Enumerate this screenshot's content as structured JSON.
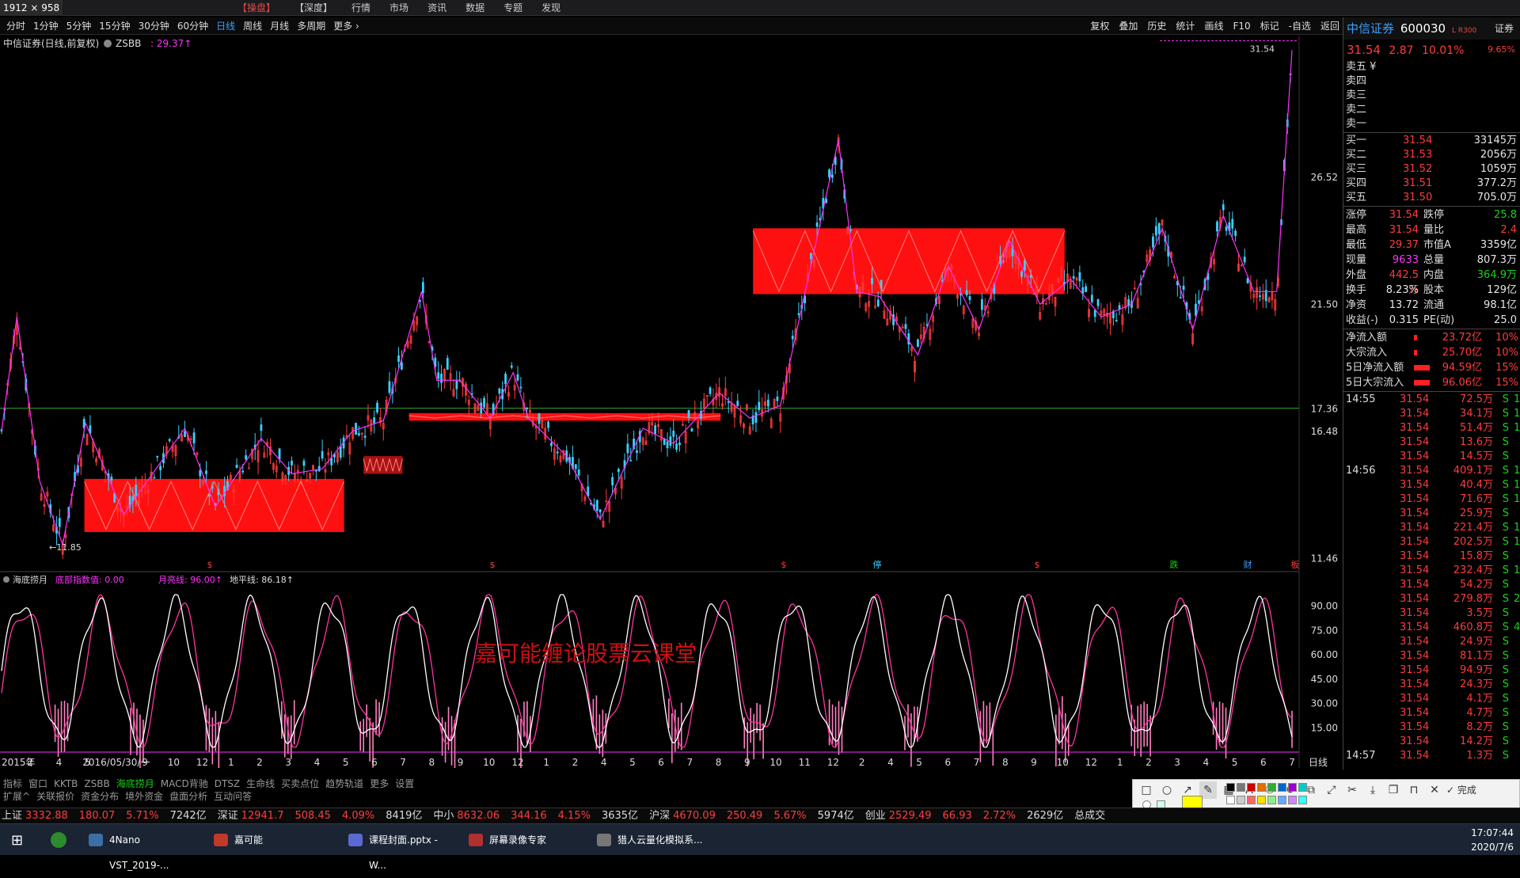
{
  "window": {
    "dims_label": "1912 × 958"
  },
  "top_menu": [
    {
      "label": "【操盘】",
      "active": true
    },
    {
      "label": "【深度】",
      "active": false
    },
    {
      "label": "行情",
      "active": false
    },
    {
      "label": "市场",
      "active": false
    },
    {
      "label": "资讯",
      "active": false
    },
    {
      "label": "数据",
      "active": false
    },
    {
      "label": "专题",
      "active": false
    },
    {
      "label": "发现",
      "active": false
    }
  ],
  "periods": [
    {
      "label": "分时",
      "active": false
    },
    {
      "label": "1分钟",
      "active": false
    },
    {
      "label": "5分钟",
      "active": false
    },
    {
      "label": "15分钟",
      "active": false
    },
    {
      "label": "30分钟",
      "active": false
    },
    {
      "label": "60分钟",
      "active": false
    },
    {
      "label": "日线",
      "active": true
    },
    {
      "label": "周线",
      "active": false
    },
    {
      "label": "月线",
      "active": false
    },
    {
      "label": "多周期",
      "active": false
    },
    {
      "label": "更多 ›",
      "active": false
    }
  ],
  "right_tools": [
    "复权",
    "叠加",
    "历史",
    "统计",
    "画线",
    "F10",
    "标记",
    "-自选",
    "返回"
  ],
  "chart_header": {
    "name": "中信证券(日线,前复权)",
    "indicator": "ZSBB",
    "indicator_value": ": 29.37↑"
  },
  "stock": {
    "name": "中信证券",
    "code": "600030",
    "tag": "L R300",
    "sec_label": "证券",
    "price": "31.54",
    "change": "2.87",
    "pct": "10.01%",
    "pct2": "9.65%"
  },
  "asks": [
    {
      "label": "卖五 ¥",
      "price": "",
      "vol": ""
    },
    {
      "label": "卖四",
      "price": "",
      "vol": ""
    },
    {
      "label": "卖三",
      "price": "",
      "vol": ""
    },
    {
      "label": "卖二",
      "price": "",
      "vol": ""
    },
    {
      "label": "卖一",
      "price": "",
      "vol": ""
    }
  ],
  "bids": [
    {
      "label": "买一",
      "price": "31.54",
      "vol": "33145万"
    },
    {
      "label": "买二",
      "price": "31.53",
      "vol": "2056万"
    },
    {
      "label": "买三",
      "price": "31.52",
      "vol": "1059万"
    },
    {
      "label": "买四",
      "price": "31.51",
      "vol": "377.2万"
    },
    {
      "label": "买五",
      "price": "31.50",
      "vol": "705.0万"
    }
  ],
  "info": [
    {
      "a": "涨停",
      "b": "31.54",
      "bc": "red",
      "c": "跌停",
      "d": "25.8",
      "dc": "grn"
    },
    {
      "a": "最高",
      "b": "31.54",
      "bc": "red",
      "c": "量比",
      "d": "2.4",
      "dc": "red"
    },
    {
      "a": "最低",
      "b": "29.37",
      "bc": "red",
      "c": "市值A",
      "d": "3359亿",
      "dc": "wht"
    },
    {
      "a": "现量",
      "b": "9633",
      "bc": "mag",
      "c": "总量",
      "d": "807.3万",
      "dc": "wht"
    },
    {
      "a": "外盘",
      "b": "442.5万",
      "bc": "red",
      "c": "内盘",
      "d": "364.9万",
      "dc": "grn"
    },
    {
      "a": "换手",
      "b": "8.23%",
      "bc": "wht",
      "c": "股本",
      "d": "129亿",
      "dc": "wht"
    },
    {
      "a": "净资",
      "b": "13.72",
      "bc": "wht",
      "c": "流通",
      "d": "98.1亿",
      "dc": "wht"
    },
    {
      "a": "收益(-)",
      "b": "0.315",
      "bc": "wht",
      "c": "PE(动)",
      "d": "25.0",
      "dc": "wht"
    }
  ],
  "flows": [
    {
      "label": "净流入额",
      "bar": 0.1,
      "value": "23.72亿",
      "pct": "10%"
    },
    {
      "label": "大宗流入",
      "bar": 0.1,
      "value": "25.70亿",
      "pct": "10%"
    },
    {
      "label": "5日净流入额",
      "bar": 0.9,
      "value": "94.59亿",
      "pct": "15%"
    },
    {
      "label": "5日大宗流入",
      "bar": 0.9,
      "value": "96.06亿",
      "pct": "15%"
    }
  ],
  "ticks": [
    {
      "time": "14:55",
      "price": "31.54",
      "vol": "72.5万",
      "side": "S",
      "extra": "1("
    },
    {
      "time": "",
      "price": "31.54",
      "vol": "34.1万",
      "side": "S",
      "extra": "1"
    },
    {
      "time": "",
      "price": "31.54",
      "vol": "51.4万",
      "side": "S",
      "extra": "1"
    },
    {
      "time": "",
      "price": "31.54",
      "vol": "13.6万",
      "side": "S",
      "extra": ""
    },
    {
      "time": "",
      "price": "31.54",
      "vol": "14.5万",
      "side": "S",
      "extra": ""
    },
    {
      "time": "14:56",
      "price": "31.54",
      "vol": "409.1万",
      "side": "S",
      "extra": "12"
    },
    {
      "time": "",
      "price": "31.54",
      "vol": "40.4万",
      "side": "S",
      "extra": "1"
    },
    {
      "time": "",
      "price": "31.54",
      "vol": "71.6万",
      "side": "S",
      "extra": "1"
    },
    {
      "time": "",
      "price": "31.54",
      "vol": "25.9万",
      "side": "S",
      "extra": ""
    },
    {
      "time": "",
      "price": "31.54",
      "vol": "221.4万",
      "side": "S",
      "extra": "1"
    },
    {
      "time": "",
      "price": "31.54",
      "vol": "202.5万",
      "side": "S",
      "extra": "1"
    },
    {
      "time": "",
      "price": "31.54",
      "vol": "15.8万",
      "side": "S",
      "extra": ""
    },
    {
      "time": "",
      "price": "31.54",
      "vol": "232.4万",
      "side": "S",
      "extra": "1"
    },
    {
      "time": "",
      "price": "31.54",
      "vol": "54.2万",
      "side": "S",
      "extra": ""
    },
    {
      "time": "",
      "price": "31.54",
      "vol": "279.8万",
      "side": "S",
      "extra": "2("
    },
    {
      "time": "",
      "price": "31.54",
      "vol": "3.5万",
      "side": "S",
      "extra": ""
    },
    {
      "time": "",
      "price": "31.54",
      "vol": "460.8万",
      "side": "S",
      "extra": "4("
    },
    {
      "time": "",
      "price": "31.54",
      "vol": "24.9万",
      "side": "S",
      "extra": ""
    },
    {
      "time": "",
      "price": "31.54",
      "vol": "81.1万",
      "side": "S",
      "extra": ""
    },
    {
      "time": "",
      "price": "31.54",
      "vol": "94.9万",
      "side": "S",
      "extra": ""
    },
    {
      "time": "",
      "price": "31.54",
      "vol": "24.3万",
      "side": "S",
      "extra": ""
    },
    {
      "time": "",
      "price": "31.54",
      "vol": "4.1万",
      "side": "S",
      "extra": ""
    },
    {
      "time": "",
      "price": "31.54",
      "vol": "4.7万",
      "side": "S",
      "extra": ""
    },
    {
      "time": "",
      "price": "31.54",
      "vol": "8.2万",
      "side": "S",
      "extra": ""
    },
    {
      "time": "",
      "price": "31.54",
      "vol": "14.2万",
      "side": "S",
      "extra": ""
    },
    {
      "time": "14:57",
      "price": "31.54",
      "vol": "1.3万",
      "side": "S",
      "extra": ""
    }
  ],
  "sub_header": {
    "name": "海底捞月",
    "a_label": "底部指数值: 0.00",
    "b_label": "月亮线: 96.00↑",
    "c_label": "地平线: 86.18↑"
  },
  "watermark": "嘉可能缠论股票云课堂",
  "bottom_tabs": [
    {
      "label": "指标",
      "active": false
    },
    {
      "label": "窗口",
      "active": false
    },
    {
      "label": "KKTB",
      "active": false
    },
    {
      "label": "ZSBB",
      "active": false
    },
    {
      "label": "海底捞月",
      "active": true
    },
    {
      "label": "MACD背驰",
      "active": false
    },
    {
      "label": "DTSZ",
      "active": false
    },
    {
      "label": "生命线",
      "active": false
    },
    {
      "label": "买卖点位",
      "active": false
    },
    {
      "label": "趋势轨道",
      "active": false
    },
    {
      "label": "更多",
      "active": false
    },
    {
      "label": "设置",
      "active": false
    }
  ],
  "bottom_tabs2": [
    "扩展^",
    "关联报价",
    "资金分布",
    "境外资金",
    "盘面分析",
    "互动问答"
  ],
  "indices": [
    {
      "name": "上证",
      "price": "3332.88",
      "chg": "180.07",
      "pct": "5.71%",
      "amt": "7242亿"
    },
    {
      "name": "深证",
      "price": "12941.7",
      "chg": "508.45",
      "pct": "4.09%",
      "amt": "8419亿"
    },
    {
      "name": "中小",
      "price": "8632.06",
      "chg": "344.16",
      "pct": "4.15%",
      "amt": "3635亿"
    },
    {
      "name": "沪深",
      "price": "4670.09",
      "chg": "250.49",
      "pct": "5.67%",
      "amt": "5974亿"
    },
    {
      "name": "创业",
      "price": "2529.49",
      "chg": "66.93",
      "pct": "2.72%",
      "amt": "2629亿"
    }
  ],
  "index_tail": "总成交",
  "taskbar": [
    {
      "label": "4Nano VST_2019-...",
      "color": "#3a6ea5"
    },
    {
      "label": "嘉可能",
      "color": "#c0392b"
    },
    {
      "label": "课程封面.pptx - W...",
      "color": "#5b6ad0"
    },
    {
      "label": "屏幕录像专家",
      "color": "#b03030"
    },
    {
      "label": "猎人云量化模拟系...",
      "color": "#777"
    }
  ],
  "clock": {
    "time": "17:07:44",
    "date": "2020/7/6"
  },
  "done_label": "完成",
  "chart_data": {
    "type": "candlestick",
    "title": "中信证券(日线,前复权)",
    "price_axis_labels": [
      "26.52",
      "21.50",
      "17.36",
      "16.48",
      "11.46"
    ],
    "price_axis_values": [
      26.52,
      21.5,
      17.36,
      16.48,
      11.46
    ],
    "price_range": [
      11.0,
      31.8
    ],
    "reference_line": 17.36,
    "high_label": "31.54",
    "low_label": "11.85",
    "x_labels": [
      "2015年",
      "2",
      "4",
      "5",
      "2016/05/30/一",
      "9",
      "10",
      "12",
      "1",
      "2",
      "3",
      "4",
      "5",
      "6",
      "7",
      "8",
      "9",
      "10",
      "12",
      "1",
      "2",
      "4",
      "5",
      "6",
      "7",
      "8",
      "9",
      "10",
      "11",
      "12",
      "2",
      "4",
      "5",
      "6",
      "7",
      "8",
      "9",
      "10",
      "12",
      "1",
      "2",
      "3",
      "4",
      "5",
      "6",
      "7",
      "日线"
    ],
    "hub_zones": [
      {
        "low": 12.5,
        "high": 14.6
      },
      {
        "low": 14.8,
        "high": 15.5
      },
      {
        "low": 16.9,
        "high": 17.2
      },
      {
        "low": 21.9,
        "high": 24.5
      }
    ],
    "osc_axis_labels": [
      "90.00",
      "75.00",
      "60.00",
      "45.00",
      "30.00",
      "15.00"
    ],
    "osc_axis_values": [
      90,
      75,
      60,
      45,
      30,
      15
    ],
    "osc_range": [
      0,
      100
    ],
    "event_marks": [
      "$",
      "$",
      "$",
      "停",
      "$",
      "跌",
      "财",
      "板"
    ]
  }
}
